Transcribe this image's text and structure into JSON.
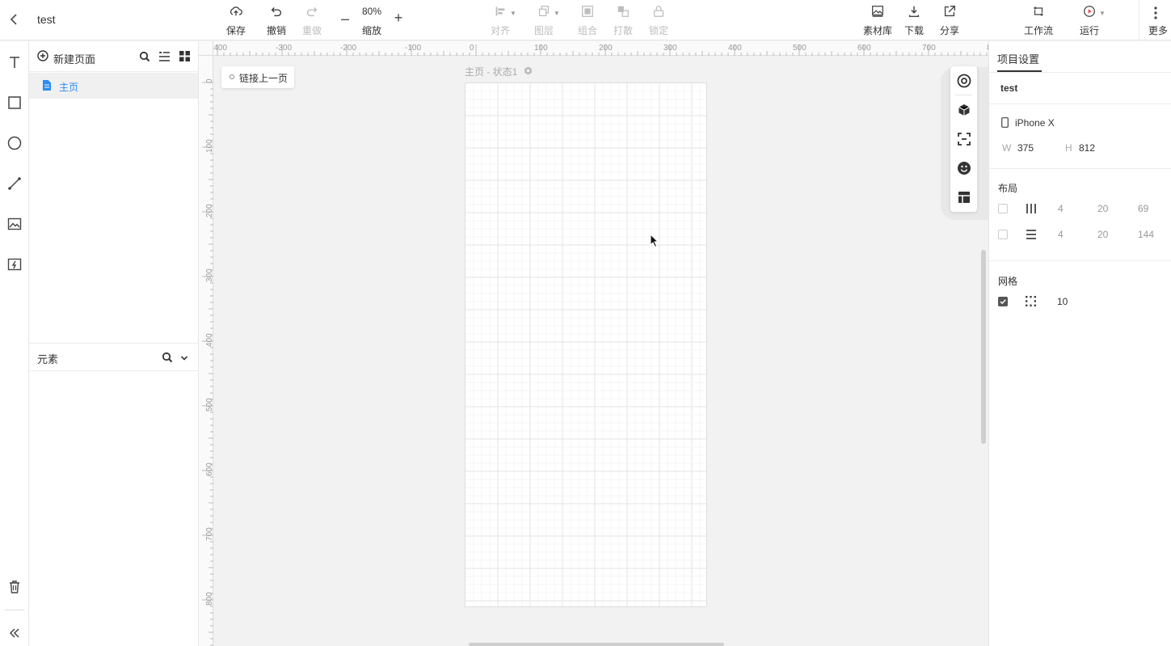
{
  "header": {
    "back_icon": "chevron-left-icon",
    "project_name": "test",
    "save": "保存",
    "undo": "撤销",
    "redo": "重做",
    "zoom_value": "80%",
    "zoom_label": "缩放",
    "align": "对齐",
    "layer": "图层",
    "group": "组合",
    "ungroup": "打散",
    "lock": "锁定",
    "assets": "素材库",
    "download": "下载",
    "share": "分享",
    "workflow": "工作流",
    "run": "运行",
    "more": "更多"
  },
  "tools": [
    "text-tool-icon",
    "rectangle-tool-icon",
    "ellipse-tool-icon",
    "line-tool-icon",
    "image-tool-icon",
    "hotspot-tool-icon"
  ],
  "pages_panel": {
    "new_page": "新建页面",
    "pages": [
      {
        "label": "主页",
        "selected": true
      }
    ]
  },
  "elements_panel": {
    "title": "元素"
  },
  "canvas": {
    "link_prev_page": "链接上一页",
    "artboard_title": "主页 - 状态1",
    "ruler_h": [
      "-400",
      "-300",
      "-200",
      "-100",
      "0",
      "100",
      "200",
      "300",
      "400",
      "500",
      "600",
      "700",
      "8"
    ],
    "ruler_v": [
      "0",
      "100",
      "200",
      "300",
      "400",
      "500",
      "600",
      "700",
      "800"
    ]
  },
  "floating_tools": [
    "target-icon",
    "cube-icon",
    "scan-icon",
    "emoji-icon",
    "template-icon"
  ],
  "settings": {
    "tab": "项目设置",
    "project_name": "test",
    "device": "iPhone X",
    "w_label": "W",
    "w_value": "375",
    "h_label": "H",
    "h_value": "812",
    "layout_title": "布局",
    "layout_columns": {
      "checked": false,
      "values": [
        "4",
        "20",
        "69"
      ]
    },
    "layout_rows": {
      "checked": false,
      "values": [
        "4",
        "20",
        "144"
      ]
    },
    "grid_title": "网格",
    "grid": {
      "checked": true,
      "value": "10"
    }
  },
  "colors": {
    "accent": "#2d8cf0",
    "run_red": "#e64a4a"
  }
}
